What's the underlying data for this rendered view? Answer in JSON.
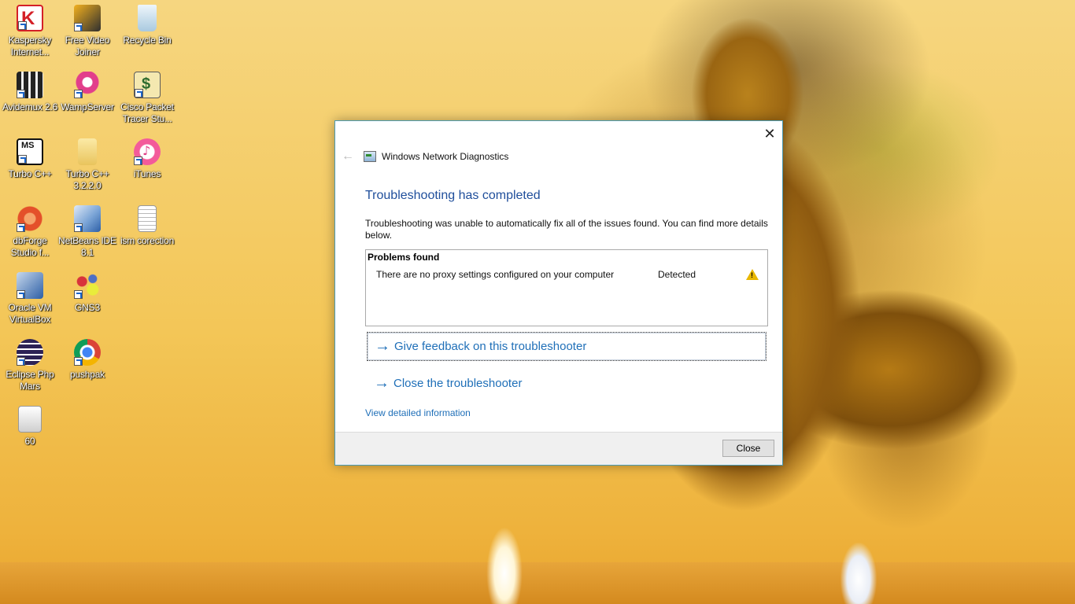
{
  "desktop": {
    "icons": [
      {
        "label": "Kaspersky Internet...",
        "icon": "kaspersky-icon",
        "color": "#d42027"
      },
      {
        "label": "Free Video Joiner",
        "icon": "video-joiner-icon",
        "color": "#f2b01e"
      },
      {
        "label": "Recycle Bin",
        "icon": "recycle-bin-icon",
        "color": "#cfe3f1"
      },
      {
        "label": "Avidemux 2.6",
        "icon": "avidemux-icon",
        "color": "#222222"
      },
      {
        "label": "WampServer",
        "icon": "wampserver-icon",
        "color": "#e23e8b"
      },
      {
        "label": "Cisco Packet Tracer Stu...",
        "icon": "cisco-packet-tracer-icon",
        "color": "#f4e8b0"
      },
      {
        "label": "Turbo C++",
        "icon": "turbo-cpp-icon",
        "color": "#ffffff"
      },
      {
        "label": "Turbo C++ 3.2.2.0",
        "icon": "folder-icon",
        "color": "#f3d77c"
      },
      {
        "label": "iTunes",
        "icon": "itunes-icon",
        "color": "#f4f4f4"
      },
      {
        "label": "dbForge Studio f...",
        "icon": "dbforge-icon",
        "color": "#e4502a"
      },
      {
        "label": "NetBeans IDE 8.1",
        "icon": "netbeans-icon",
        "color": "#7aa4d6"
      },
      {
        "label": "ism corection",
        "icon": "text-file-icon",
        "color": "#ffffff"
      },
      {
        "label": "Oracle VM VirtualBox",
        "icon": "virtualbox-icon",
        "color": "#2d5fa6"
      },
      {
        "label": "GNS3",
        "icon": "gns3-icon",
        "color": "#c8d43a"
      },
      {
        "label": "Eclipse Php Mars",
        "icon": "eclipse-icon",
        "color": "#2c2255"
      },
      {
        "label": "pushpak",
        "icon": "chrome-icon",
        "color": "#4285f4"
      },
      {
        "label": "60",
        "icon": "image-file-icon",
        "color": "#e8e8e8"
      }
    ]
  },
  "dialog": {
    "close_glyph": "✕",
    "back_glyph": "←",
    "window_title": "Windows Network Diagnostics",
    "heading": "Troubleshooting has completed",
    "description": "Troubleshooting was unable to automatically fix all of the issues found. You can find more details below.",
    "problems": {
      "header": "Problems found",
      "items": [
        {
          "text": "There are no proxy settings configured on your computer",
          "status": "Detected",
          "icon": "warning-icon"
        }
      ]
    },
    "links": {
      "arrow_glyph": "→",
      "feedback": "Give feedback on this troubleshooter",
      "close_troubleshooter": "Close the troubleshooter",
      "view_details": "View detailed information"
    },
    "close_button": "Close",
    "accent_color": "#1f6fb8",
    "heading_color": "#1f4e9b"
  }
}
